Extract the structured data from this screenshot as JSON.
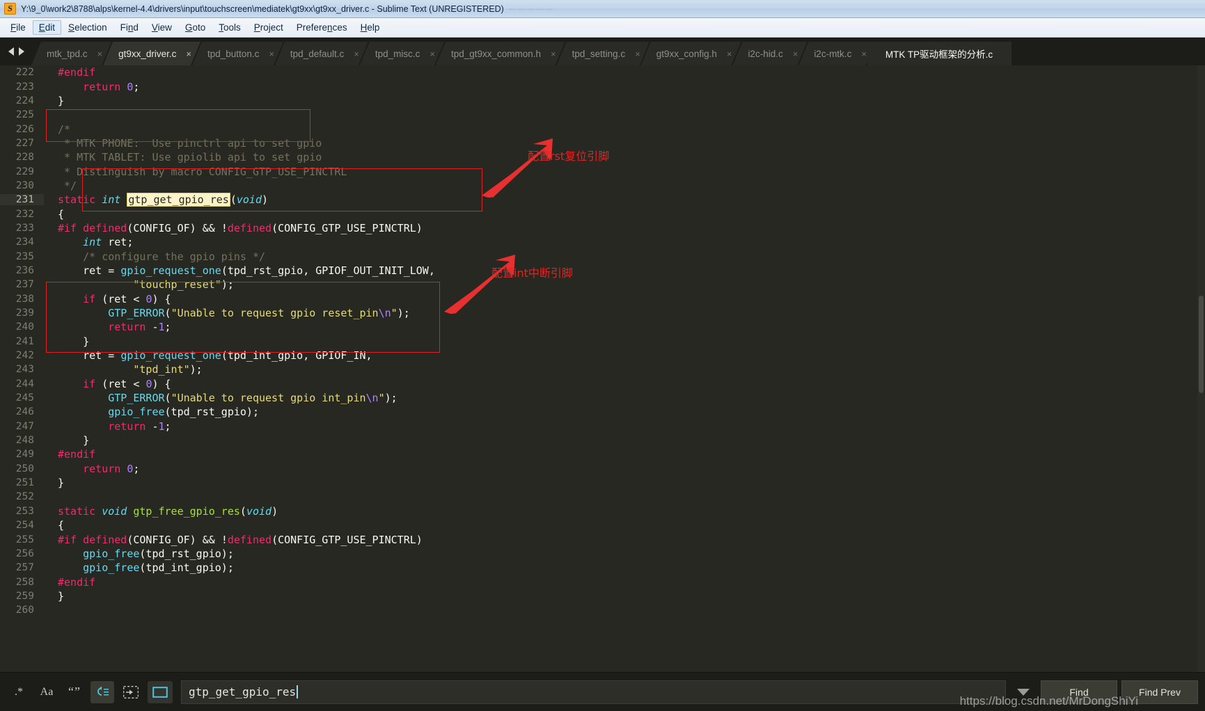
{
  "window": {
    "title": "Y:\\9_0\\work2\\8788\\alps\\kernel-4.4\\drivers\\input\\touchscreen\\mediatek\\gt9xx\\gt9xx_driver.c - Sublime Text (UNREGISTERED)",
    "ghost_title": "—————",
    "app_icon": "sublime-text-icon"
  },
  "menubar": [
    {
      "label": "File",
      "mnemonic": "F"
    },
    {
      "label": "Edit",
      "mnemonic": "E",
      "active": true
    },
    {
      "label": "Selection",
      "mnemonic": "S"
    },
    {
      "label": "Find",
      "mnemonic": "n"
    },
    {
      "label": "View",
      "mnemonic": "V"
    },
    {
      "label": "Goto",
      "mnemonic": "G"
    },
    {
      "label": "Tools",
      "mnemonic": "T"
    },
    {
      "label": "Project",
      "mnemonic": "P"
    },
    {
      "label": "Preferences",
      "mnemonic": "n"
    },
    {
      "label": "Help",
      "mnemonic": "H"
    }
  ],
  "tabs": {
    "close_glyph": "×",
    "items": [
      {
        "label": "mtk_tpd.c",
        "active": false,
        "closable": true
      },
      {
        "label": "gt9xx_driver.c",
        "active": true,
        "closable": true
      },
      {
        "label": "tpd_button.c",
        "active": false,
        "closable": true
      },
      {
        "label": "tpd_default.c",
        "active": false,
        "closable": true
      },
      {
        "label": "tpd_misc.c",
        "active": false,
        "closable": true
      },
      {
        "label": "tpd_gt9xx_common.h",
        "active": false,
        "closable": true
      },
      {
        "label": "tpd_setting.c",
        "active": false,
        "closable": true
      },
      {
        "label": "gt9xx_config.h",
        "active": false,
        "closable": true
      },
      {
        "label": "i2c-hid.c",
        "active": false,
        "closable": true
      },
      {
        "label": "i2c-mtk.c",
        "active": false,
        "closable": true
      },
      {
        "label": "MTK TP驱动框架的分析.c",
        "active": false,
        "closable": false
      }
    ]
  },
  "editor": {
    "first_line": 222,
    "cursor_line": 231,
    "lines": [
      {
        "n": 222,
        "tokens": [
          {
            "t": "#endif",
            "c": "kw"
          }
        ]
      },
      {
        "n": 223,
        "tokens": [
          {
            "t": "    ",
            "c": "plain"
          },
          {
            "t": "return",
            "c": "kw"
          },
          {
            "t": " ",
            "c": "plain"
          },
          {
            "t": "0",
            "c": "num"
          },
          {
            "t": ";",
            "c": "plain"
          }
        ]
      },
      {
        "n": 224,
        "tokens": [
          {
            "t": "}",
            "c": "plain"
          }
        ]
      },
      {
        "n": 225,
        "tokens": []
      },
      {
        "n": 226,
        "tokens": [
          {
            "t": "/*",
            "c": "cmt"
          }
        ]
      },
      {
        "n": 227,
        "tokens": [
          {
            "t": " * MTK PHONE:  Use pinctrl api to set gpio",
            "c": "cmt"
          }
        ]
      },
      {
        "n": 228,
        "tokens": [
          {
            "t": " * MTK TABLET: Use gpiolib api to set gpio",
            "c": "cmt"
          }
        ]
      },
      {
        "n": 229,
        "tokens": [
          {
            "t": " * Distinguish by macro CONFIG_GTP_USE_PINCTRL",
            "c": "cmt"
          }
        ]
      },
      {
        "n": 230,
        "tokens": [
          {
            "t": " */",
            "c": "cmt"
          }
        ]
      },
      {
        "n": 231,
        "tokens": [
          {
            "t": "static",
            "c": "kw"
          },
          {
            "t": " ",
            "c": "plain"
          },
          {
            "t": "int",
            "c": "type"
          },
          {
            "t": " ",
            "c": "plain"
          },
          {
            "t": "gtp_get_gpio_res",
            "c": "hl"
          },
          {
            "t": "(",
            "c": "plain"
          },
          {
            "t": "void",
            "c": "type"
          },
          {
            "t": ")",
            "c": "plain"
          }
        ]
      },
      {
        "n": 232,
        "tokens": [
          {
            "t": "{",
            "c": "plain"
          }
        ]
      },
      {
        "n": 233,
        "tokens": [
          {
            "t": "#if",
            "c": "kw"
          },
          {
            "t": " ",
            "c": "plain"
          },
          {
            "t": "defined",
            "c": "kw"
          },
          {
            "t": "(CONFIG_OF) && ",
            "c": "plain"
          },
          {
            "t": "!",
            "c": "plain"
          },
          {
            "t": "defined",
            "c": "kw"
          },
          {
            "t": "(CONFIG_GTP_USE_PINCTRL)",
            "c": "plain"
          }
        ]
      },
      {
        "n": 234,
        "tokens": [
          {
            "t": "    ",
            "c": "plain"
          },
          {
            "t": "int",
            "c": "type"
          },
          {
            "t": " ret;",
            "c": "plain"
          }
        ]
      },
      {
        "n": 235,
        "tokens": [
          {
            "t": "    /* configure the gpio pins */",
            "c": "cmt"
          }
        ]
      },
      {
        "n": 236,
        "tokens": [
          {
            "t": "    ret = ",
            "c": "plain"
          },
          {
            "t": "gpio_request_one",
            "c": "call"
          },
          {
            "t": "(tpd_rst_gpio, GPIOF_OUT_INIT_LOW,",
            "c": "plain"
          }
        ]
      },
      {
        "n": 237,
        "tokens": [
          {
            "t": "            ",
            "c": "plain"
          },
          {
            "t": "\"touchp_reset\"",
            "c": "str"
          },
          {
            "t": ");",
            "c": "plain"
          }
        ]
      },
      {
        "n": 238,
        "tokens": [
          {
            "t": "    ",
            "c": "plain"
          },
          {
            "t": "if",
            "c": "kw"
          },
          {
            "t": " (ret < ",
            "c": "plain"
          },
          {
            "t": "0",
            "c": "num"
          },
          {
            "t": ") {",
            "c": "plain"
          }
        ]
      },
      {
        "n": 239,
        "tokens": [
          {
            "t": "        ",
            "c": "plain"
          },
          {
            "t": "GTP_ERROR",
            "c": "call"
          },
          {
            "t": "(",
            "c": "plain"
          },
          {
            "t": "\"Unable to request gpio reset_pin",
            "c": "str"
          },
          {
            "t": "\\n",
            "c": "esc"
          },
          {
            "t": "\"",
            "c": "str"
          },
          {
            "t": ");",
            "c": "plain"
          }
        ]
      },
      {
        "n": 240,
        "tokens": [
          {
            "t": "        ",
            "c": "plain"
          },
          {
            "t": "return",
            "c": "kw"
          },
          {
            "t": " -",
            "c": "plain"
          },
          {
            "t": "1",
            "c": "num"
          },
          {
            "t": ";",
            "c": "plain"
          }
        ]
      },
      {
        "n": 241,
        "tokens": [
          {
            "t": "    }",
            "c": "plain"
          }
        ]
      },
      {
        "n": 242,
        "tokens": [
          {
            "t": "    ret = ",
            "c": "plain"
          },
          {
            "t": "gpio_request_one",
            "c": "call"
          },
          {
            "t": "(tpd_int_gpio, GPIOF_IN,",
            "c": "plain"
          }
        ]
      },
      {
        "n": 243,
        "tokens": [
          {
            "t": "            ",
            "c": "plain"
          },
          {
            "t": "\"tpd_int\"",
            "c": "str"
          },
          {
            "t": ");",
            "c": "plain"
          }
        ]
      },
      {
        "n": 244,
        "tokens": [
          {
            "t": "    ",
            "c": "plain"
          },
          {
            "t": "if",
            "c": "kw"
          },
          {
            "t": " (ret < ",
            "c": "plain"
          },
          {
            "t": "0",
            "c": "num"
          },
          {
            "t": ") {",
            "c": "plain"
          }
        ]
      },
      {
        "n": 245,
        "tokens": [
          {
            "t": "        ",
            "c": "plain"
          },
          {
            "t": "GTP_ERROR",
            "c": "call"
          },
          {
            "t": "(",
            "c": "plain"
          },
          {
            "t": "\"Unable to request gpio int_pin",
            "c": "str"
          },
          {
            "t": "\\n",
            "c": "esc"
          },
          {
            "t": "\"",
            "c": "str"
          },
          {
            "t": ");",
            "c": "plain"
          }
        ]
      },
      {
        "n": 246,
        "tokens": [
          {
            "t": "        ",
            "c": "plain"
          },
          {
            "t": "gpio_free",
            "c": "call"
          },
          {
            "t": "(tpd_rst_gpio);",
            "c": "plain"
          }
        ]
      },
      {
        "n": 247,
        "tokens": [
          {
            "t": "        ",
            "c": "plain"
          },
          {
            "t": "return",
            "c": "kw"
          },
          {
            "t": " -",
            "c": "plain"
          },
          {
            "t": "1",
            "c": "num"
          },
          {
            "t": ";",
            "c": "plain"
          }
        ]
      },
      {
        "n": 248,
        "tokens": [
          {
            "t": "    }",
            "c": "plain"
          }
        ]
      },
      {
        "n": 249,
        "tokens": [
          {
            "t": "#endif",
            "c": "kw"
          }
        ]
      },
      {
        "n": 250,
        "tokens": [
          {
            "t": "    ",
            "c": "plain"
          },
          {
            "t": "return",
            "c": "kw"
          },
          {
            "t": " ",
            "c": "plain"
          },
          {
            "t": "0",
            "c": "num"
          },
          {
            "t": ";",
            "c": "plain"
          }
        ]
      },
      {
        "n": 251,
        "tokens": [
          {
            "t": "}",
            "c": "plain"
          }
        ]
      },
      {
        "n": 252,
        "tokens": []
      },
      {
        "n": 253,
        "tokens": [
          {
            "t": "static",
            "c": "kw"
          },
          {
            "t": " ",
            "c": "plain"
          },
          {
            "t": "void",
            "c": "type"
          },
          {
            "t": " ",
            "c": "plain"
          },
          {
            "t": "gtp_free_gpio_res",
            "c": "fn"
          },
          {
            "t": "(",
            "c": "plain"
          },
          {
            "t": "void",
            "c": "type"
          },
          {
            "t": ")",
            "c": "plain"
          }
        ]
      },
      {
        "n": 254,
        "tokens": [
          {
            "t": "{",
            "c": "plain"
          }
        ]
      },
      {
        "n": 255,
        "tokens": [
          {
            "t": "#if",
            "c": "kw"
          },
          {
            "t": " ",
            "c": "plain"
          },
          {
            "t": "defined",
            "c": "kw"
          },
          {
            "t": "(CONFIG_OF) && ",
            "c": "plain"
          },
          {
            "t": "!",
            "c": "plain"
          },
          {
            "t": "defined",
            "c": "kw"
          },
          {
            "t": "(CONFIG_GTP_USE_PINCTRL)",
            "c": "plain"
          }
        ]
      },
      {
        "n": 256,
        "tokens": [
          {
            "t": "    ",
            "c": "plain"
          },
          {
            "t": "gpio_free",
            "c": "call"
          },
          {
            "t": "(tpd_rst_gpio);",
            "c": "plain"
          }
        ]
      },
      {
        "n": 257,
        "tokens": [
          {
            "t": "    ",
            "c": "plain"
          },
          {
            "t": "gpio_free",
            "c": "call"
          },
          {
            "t": "(tpd_int_gpio);",
            "c": "plain"
          }
        ]
      },
      {
        "n": 258,
        "tokens": [
          {
            "t": "#endif",
            "c": "kw"
          }
        ]
      },
      {
        "n": 259,
        "tokens": [
          {
            "t": "}",
            "c": "plain"
          }
        ]
      },
      {
        "n": 260,
        "tokens": []
      }
    ]
  },
  "annotations": {
    "color": "#e02424",
    "items": [
      {
        "text": "配置rst复位引脚",
        "name": "annotation-rst-reset-pin"
      },
      {
        "text": "配置int中断引脚",
        "name": "annotation-int-interrupt-pin"
      }
    ]
  },
  "findbar": {
    "toggles": [
      {
        "icon": "regex-icon",
        "glyph": ".*",
        "active": false
      },
      {
        "icon": "case-sensitive-icon",
        "glyph": "Aa",
        "active": false
      },
      {
        "icon": "whole-word-icon",
        "glyph": "“”",
        "active": false
      },
      {
        "icon": "wrap-icon",
        "glyph": "",
        "active": true
      },
      {
        "icon": "in-selection-icon",
        "glyph": "",
        "active": false
      },
      {
        "icon": "highlight-results-icon",
        "glyph": "",
        "active": true
      }
    ],
    "query": "gtp_get_gpio_res",
    "placeholder": "Find",
    "history_caret": "history-dropdown-icon",
    "buttons": [
      {
        "label": "Find",
        "name": "find-button"
      },
      {
        "label": "Find Prev",
        "name": "find-prev-button"
      }
    ]
  },
  "watermark": {
    "text": "https://blog.csdn.net/MrDongShiYi"
  }
}
